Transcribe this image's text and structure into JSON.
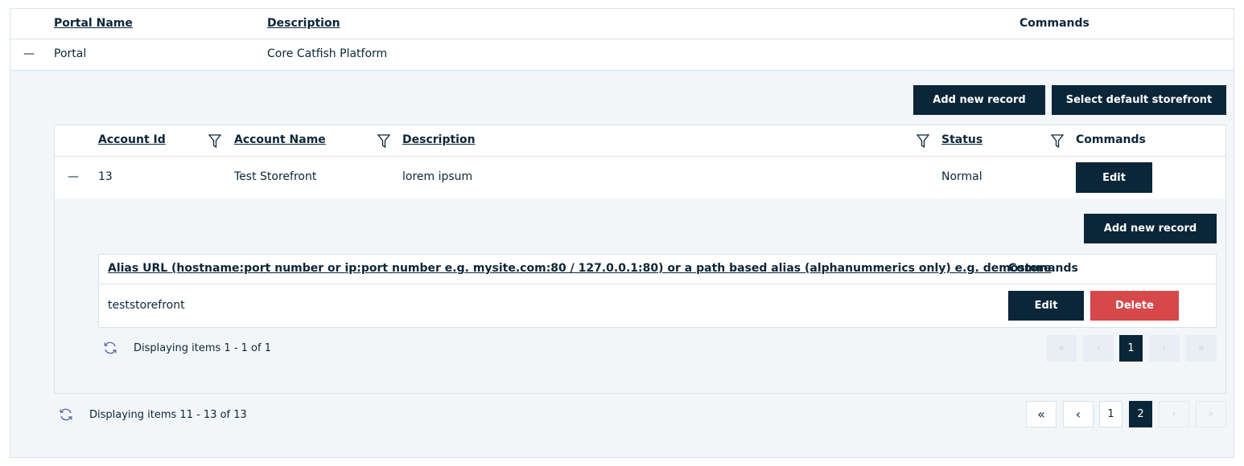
{
  "portal_grid": {
    "columns": {
      "portal_name": "Portal Name",
      "description": "Description",
      "commands": "Commands"
    },
    "row": {
      "toggle": "—",
      "portal_name": "Portal",
      "description": "Core Catfish Platform"
    },
    "toolbar": {
      "add_new_record": "Add new record",
      "select_default_storefront": "Select default storefront"
    },
    "pager": {
      "info": "Displaying items 11 - 13 of 13",
      "pages": [
        "1",
        "2"
      ],
      "current_page": "2",
      "first": "«",
      "prev": "‹",
      "next": "›",
      "last": "»"
    }
  },
  "account_grid": {
    "columns": {
      "account_id": "Account Id",
      "account_name": "Account Name",
      "description": "Description",
      "status": "Status",
      "commands": "Commands"
    },
    "row": {
      "toggle": "—",
      "account_id": "13",
      "account_name": "Test Storefront",
      "description": "lorem ipsum",
      "status": "Normal",
      "edit": "Edit"
    },
    "toolbar": {
      "add_new_record": "Add new record"
    },
    "pager": {
      "info": "Displaying items 1 - 1 of 1",
      "pages": [
        "1"
      ],
      "current_page": "1",
      "first": "«",
      "prev": "‹",
      "next": "›",
      "last": "»"
    }
  },
  "alias_grid": {
    "columns": {
      "alias_url": "Alias URL (hostname:port number or ip:port number e.g. mysite.com:80 / 127.0.0.1:80) or a path based alias (alphanummerics only) e.g. demostore",
      "commands": "Commands"
    },
    "row": {
      "alias": "teststorefront",
      "edit": "Edit",
      "delete": "Delete"
    }
  },
  "icons": {
    "refresh": "refresh-icon",
    "filter": "filter-icon"
  },
  "colors": {
    "primary": "#0b2638",
    "danger": "#d6484a",
    "panel": "#f3f6f9",
    "border": "#d8e2ea"
  }
}
